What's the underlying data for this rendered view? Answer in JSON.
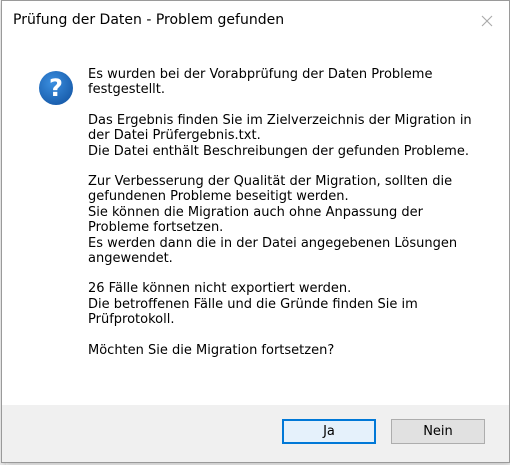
{
  "window": {
    "title": "Prüfung der Daten - Problem gefunden",
    "close_icon": "close-icon"
  },
  "icon": {
    "name": "question-icon",
    "glyph": "?",
    "color": "#1a67b8"
  },
  "message": {
    "paragraphs": [
      [
        "Es wurden bei der Vorabprüfung der Daten Probleme",
        "festgestellt."
      ],
      [
        "Das Ergebnis finden Sie im Zielverzeichnis der Migration in",
        "der Datei Prüfergebnis.txt.",
        "Die Datei enthält Beschreibungen der gefunden Probleme."
      ],
      [
        "Zur Verbesserung der Qualität der Migration, sollten die",
        "gefundenen Probleme beseitigt werden.",
        "Sie können die Migration auch ohne Anpassung der",
        "Probleme fortsetzen.",
        "Es werden dann die in der Datei angegebenen Lösungen",
        "angewendet."
      ],
      [
        "26 Fälle können nicht exportiert werden.",
        "Die betroffenen Fälle und die Gründe finden Sie im",
        "Prüfprotokoll."
      ],
      [
        "Möchten Sie die Migration fortsetzen?"
      ]
    ]
  },
  "buttons": {
    "yes_label": "Ja",
    "no_label": "Nein"
  },
  "colors": {
    "accent": "#0078d7",
    "footer_bg": "#f0f0f0"
  }
}
